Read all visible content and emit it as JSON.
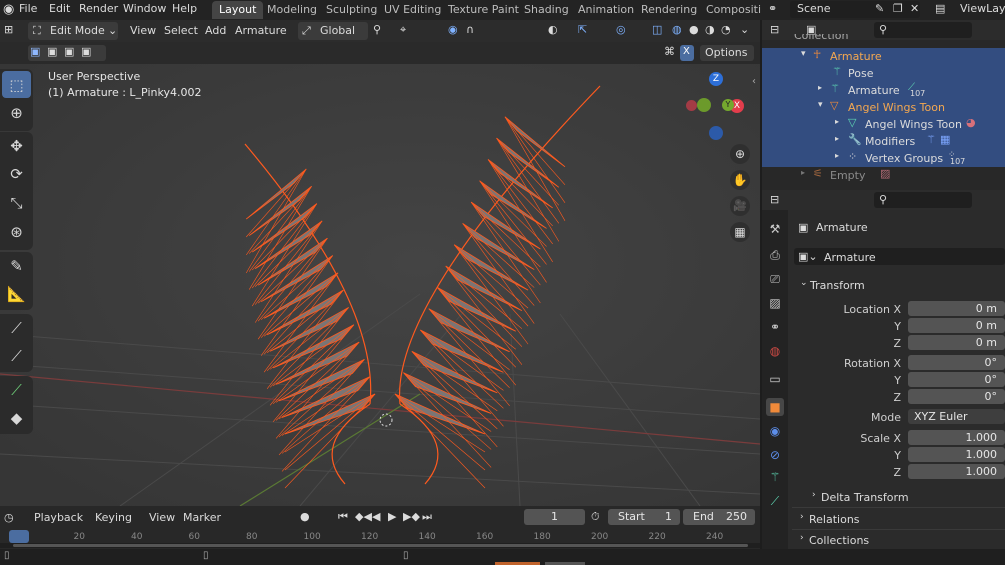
{
  "menu": [
    "File",
    "Edit",
    "Render",
    "Window",
    "Help"
  ],
  "workspaces": [
    "Layout",
    "Modeling",
    "Sculpting",
    "UV Editing",
    "Texture Paint",
    "Shading",
    "Animation",
    "Rendering",
    "Compositin"
  ],
  "scene": "Scene",
  "viewlayer": "ViewLaye",
  "header": {
    "mode": "Edit Mode",
    "view": "View",
    "select": "Select",
    "add": "Add",
    "armature": "Armature",
    "orientation": "Global",
    "options": "Options",
    "x_badge": "X"
  },
  "viewport": {
    "perspective": "User Perspective",
    "object_info": "(1) Armature : L_Pinky4.002",
    "gizmo": {
      "z": "Z",
      "y": "Y",
      "x": "X"
    },
    "wing_color": "#ff5a1e"
  },
  "outliner": {
    "rows": [
      {
        "label": "Collection",
        "indent": 0
      },
      {
        "label": "Armature",
        "indent": 1,
        "selected": true,
        "highlight": true
      },
      {
        "label": "Pose",
        "indent": 2
      },
      {
        "label": "Armature",
        "indent": 2,
        "badge": "107"
      },
      {
        "label": "Angel Wings Toon",
        "indent": 2,
        "highlight": true
      },
      {
        "label": "Angel Wings Toon",
        "indent": 3
      },
      {
        "label": "Modifiers",
        "indent": 3
      },
      {
        "label": "Vertex Groups",
        "indent": 3,
        "badge": "107"
      },
      {
        "label": "Empty",
        "indent": 1,
        "dim": true
      }
    ]
  },
  "properties": {
    "object_name": "Armature",
    "data_name": "Armature",
    "transform_label": "Transform",
    "location": {
      "label": "Location X",
      "x": "0 m",
      "y": "0 m",
      "z": "0 m"
    },
    "rotation": {
      "label": "Rotation X",
      "x": "0°",
      "y": "0°",
      "z": "0°"
    },
    "axis": {
      "y": "Y",
      "z": "Z"
    },
    "mode": {
      "label": "Mode",
      "value": "XYZ Euler"
    },
    "scale": {
      "label": "Scale X",
      "x": "1.000",
      "y": "1.000",
      "z": "1.000"
    },
    "delta": "Delta Transform",
    "relations": "Relations",
    "collections": "Collections"
  },
  "timeline": {
    "playback": "Playback",
    "keying": "Keying",
    "view": "View",
    "marker": "Marker",
    "current": "1",
    "start_label": "Start",
    "start": "1",
    "end_label": "End",
    "end": "250",
    "ticks": [
      "0",
      "20",
      "40",
      "60",
      "80",
      "100",
      "120",
      "140",
      "160",
      "180",
      "200",
      "220",
      "240"
    ]
  }
}
